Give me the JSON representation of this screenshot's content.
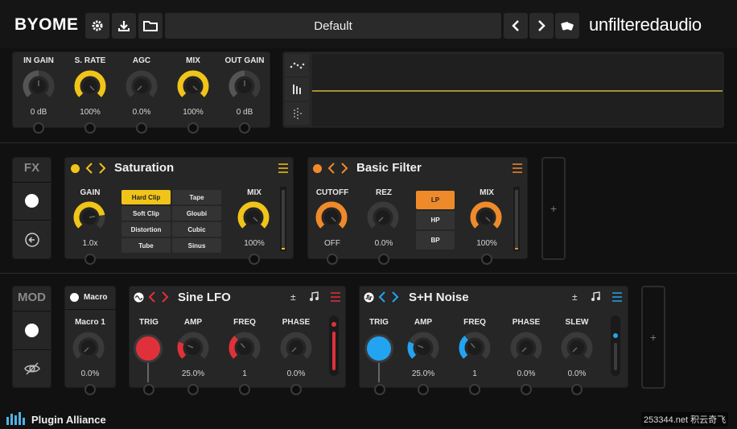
{
  "header": {
    "logo": "BYOME",
    "preset_name": "Default",
    "brand": "unfilteredaudio",
    "icons": [
      "gear-icon",
      "download-icon",
      "folder-icon",
      "prev-icon",
      "next-icon",
      "dice-icon"
    ]
  },
  "io": {
    "knobs": [
      {
        "label": "IN GAIN",
        "value": "0 dB",
        "level": 0.5,
        "color": "#3a3a3a"
      },
      {
        "label": "S. RATE",
        "value": "100%",
        "level": 1.0,
        "color": "#f0c419"
      },
      {
        "label": "AGC",
        "value": "0.0%",
        "level": 0.0,
        "color": "#3a3a3a"
      },
      {
        "label": "MIX",
        "value": "100%",
        "level": 1.0,
        "color": "#f0c419"
      },
      {
        "label": "OUT GAIN",
        "value": "0 dB",
        "level": 0.5,
        "color": "#3a3a3a"
      }
    ]
  },
  "fx": {
    "label": "FX",
    "add": "+",
    "saturation": {
      "title": "Saturation",
      "dot_color": "#f0c419",
      "gain_label": "GAIN",
      "gain_value": "1.0x",
      "gain_level": 0.8,
      "mix_label": "MIX",
      "mix_value": "100%",
      "mix_level": 1.0,
      "modes": [
        "Hard Clip",
        "Tape",
        "Soft Clip",
        "Gloubi",
        "Distortion",
        "Cubic",
        "Tube",
        "Sinus"
      ],
      "selected": "Hard Clip"
    },
    "filter": {
      "title": "Basic Filter",
      "dot_color": "#ef8a2a",
      "cutoff_label": "CUTOFF",
      "cutoff_value": "OFF",
      "cutoff_level": 1.0,
      "rez_label": "REZ",
      "rez_value": "0.0%",
      "rez_level": 0.0,
      "mix_label": "MIX",
      "mix_value": "100%",
      "mix_level": 1.0,
      "types": [
        "LP",
        "HP",
        "BP"
      ],
      "selected": "LP"
    }
  },
  "mod": {
    "label": "MOD",
    "add": "+",
    "macro": {
      "title": "Macro",
      "label": "Macro 1",
      "value": "0.0%",
      "level": 0.0
    },
    "lfo": {
      "title": "Sine LFO",
      "color": "#e0313a",
      "trig_label": "TRIG",
      "knobs": [
        {
          "label": "AMP",
          "value": "25.0%",
          "level": 0.25
        },
        {
          "label": "FREQ",
          "value": "1",
          "level": 0.35
        },
        {
          "label": "PHASE",
          "value": "0.0%",
          "level": 0.0
        }
      ]
    },
    "noise": {
      "title": "S+H Noise",
      "color": "#23a4f2",
      "trig_label": "TRIG",
      "knobs": [
        {
          "label": "AMP",
          "value": "25.0%",
          "level": 0.25
        },
        {
          "label": "FREQ",
          "value": "1",
          "level": 0.35
        },
        {
          "label": "PHASE",
          "value": "0.0%",
          "level": 0.0
        },
        {
          "label": "SLEW",
          "value": "0.0%",
          "level": 0.0
        }
      ]
    }
  },
  "footer": {
    "brand": "Plugin Alliance",
    "watermark": "253344.net 积云奇飞"
  }
}
